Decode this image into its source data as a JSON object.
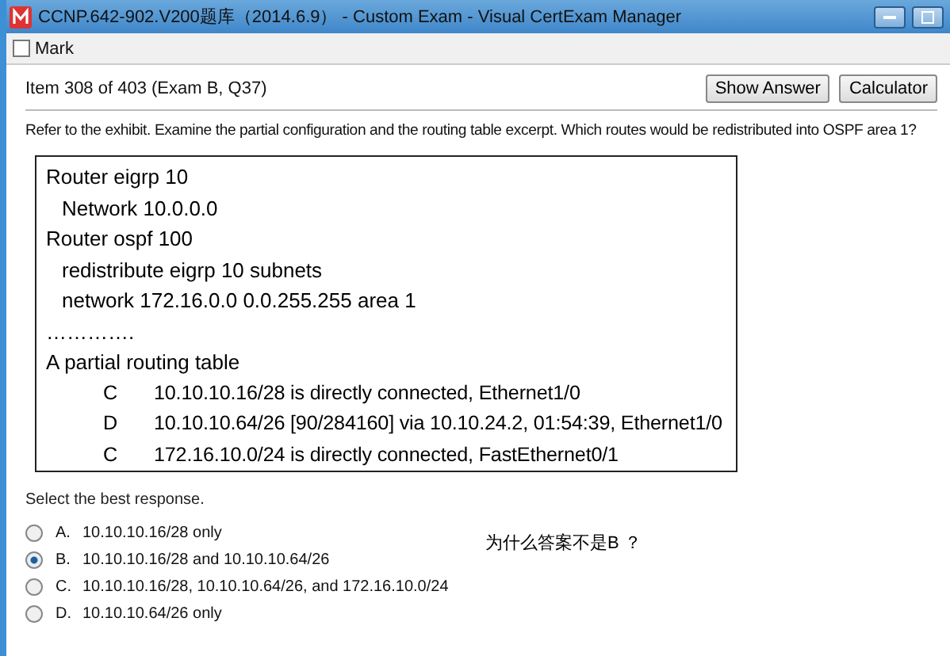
{
  "window": {
    "title": "CCNP.642-902.V200题库（2014.6.9） - Custom Exam - Visual CertExam Manager"
  },
  "toolbar": {
    "mark": {
      "label": "Mark",
      "checked": false
    }
  },
  "item": {
    "counter": "Item 308 of 403  (Exam B, Q37)",
    "buttons": [
      "Show Answer",
      "Calculator"
    ]
  },
  "question": "Refer to the exhibit. Examine the partial configuration and the routing table excerpt. Which routes would be redistributed into OSPF area 1?",
  "exhibit": {
    "lines": [
      {
        "kind": "text",
        "text": "Router eigrp 10"
      },
      {
        "kind": "indent",
        "text": "Network 10.0.0.0"
      },
      {
        "kind": "text",
        "text": "Router ospf 100"
      },
      {
        "kind": "indent",
        "text": "redistribute eigrp 10 subnets"
      },
      {
        "kind": "indent",
        "text": "network 172.16.0.0 0.0.255.255 area 1"
      },
      {
        "kind": "text",
        "text": "…………."
      },
      {
        "kind": "text",
        "text": "A partial routing table"
      },
      {
        "kind": "route",
        "code": "C",
        "text": "10.10.10.16/28 is directly connected, Ethernet1/0"
      },
      {
        "kind": "route",
        "code": "D",
        "text": "10.10.10.64/26 [90/284160] via 10.10.24.2, 01:54:39, Ethernet1/0"
      },
      {
        "kind": "route",
        "code": "C",
        "text": "172.16.10.0/24 is directly connected, FastEthernet0/1"
      }
    ]
  },
  "prompt": "Select the best response.",
  "note": "为什么答案不是B ？",
  "options": [
    {
      "letter": "A.",
      "text": "10.10.10.16/28 only",
      "selected": false
    },
    {
      "letter": "B.",
      "text": "10.10.10.16/28 and 10.10.10.64/26",
      "selected": true
    },
    {
      "letter": "C.",
      "text": "10.10.10.16/28, 10.10.10.64/26, and 172.16.10.0/24",
      "selected": false
    },
    {
      "letter": "D.",
      "text": "10.10.10.64/26 only",
      "selected": false
    }
  ]
}
